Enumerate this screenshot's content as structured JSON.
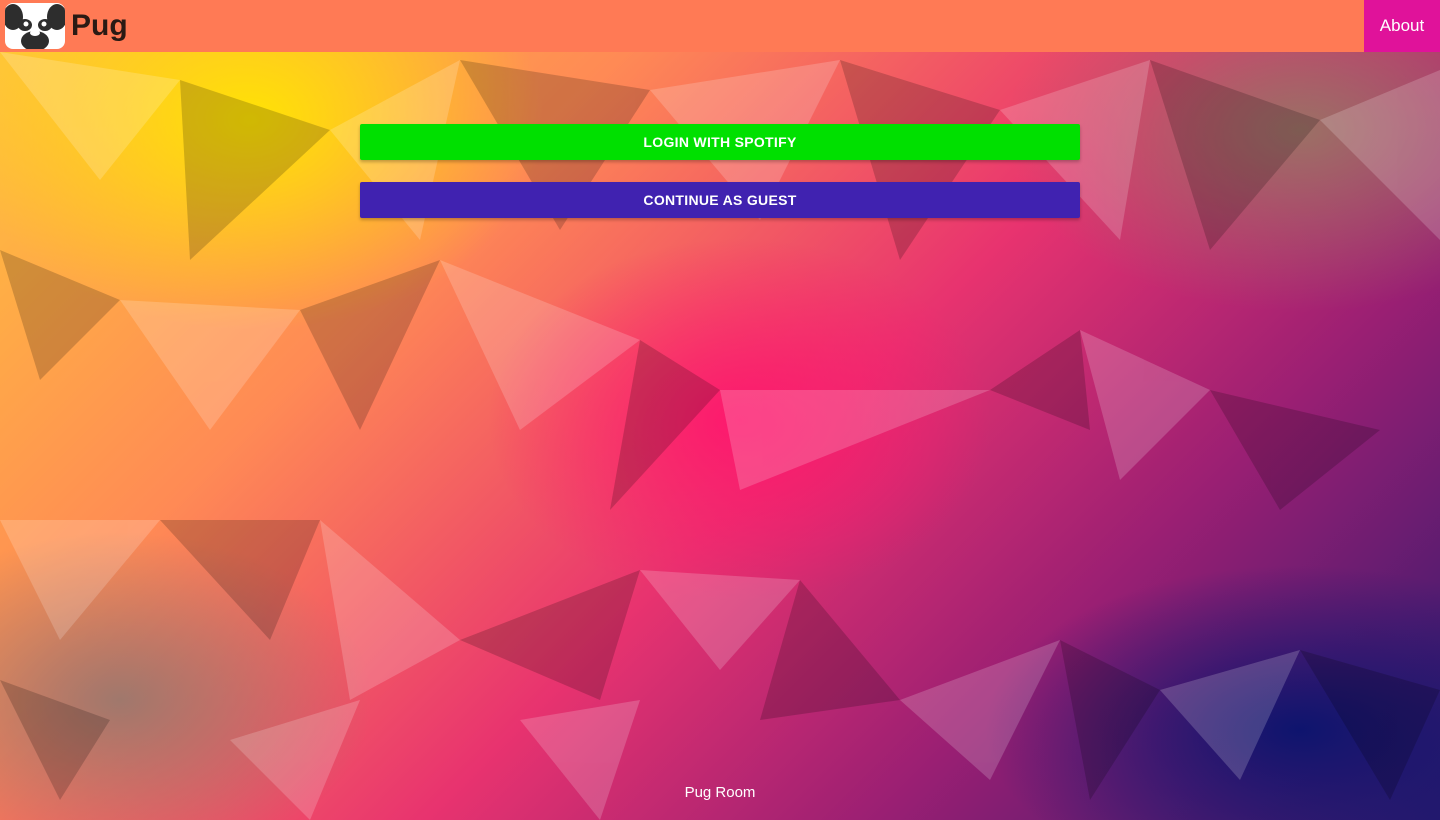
{
  "app": {
    "name": "Pug"
  },
  "header": {
    "about_label": "About"
  },
  "actions": {
    "spotify_label": "LOGIN WITH SPOTIFY",
    "guest_label": "CONTINUE AS GUEST"
  },
  "footer": {
    "text": "Pug Room"
  },
  "colors": {
    "header_bg": "#ff7a55",
    "about_bg": "#e0129a",
    "spotify_button": "#00e000",
    "guest_button": "#4022b0"
  },
  "icons": {
    "logo": "pug-face-icon"
  }
}
